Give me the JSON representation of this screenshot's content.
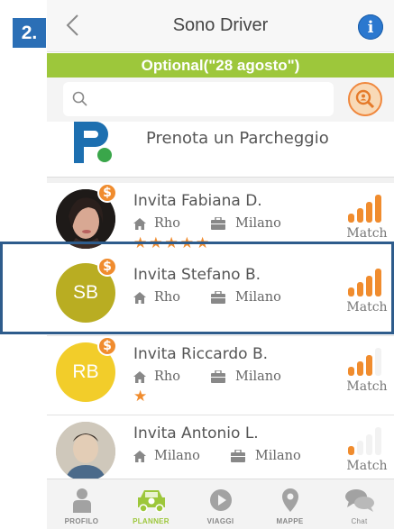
{
  "step_badge": "2.",
  "header": {
    "title": "Sono Driver",
    "info_glyph": "i"
  },
  "banner": {
    "text": "Optional(\"28 agosto\")",
    "color": "#9dc73b"
  },
  "search": {
    "placeholder": ""
  },
  "parking": {
    "label": "Prenota un Parcheggio",
    "logo_letter": "P"
  },
  "rows": [
    {
      "name": "Invita Fabiana D.",
      "home": "Rho",
      "work": "Milano",
      "stars": "★★★★★",
      "match_level": 4,
      "match_label": "Match",
      "avatar_initials": "",
      "avatar_color": "#2b2b2b",
      "has_dollar": true
    },
    {
      "name": "Invita Stefano B.",
      "home": "Rho",
      "work": "Milano",
      "stars": "",
      "match_level": 4,
      "match_label": "Match",
      "avatar_initials": "SB",
      "avatar_color": "#b9ad22",
      "has_dollar": true
    },
    {
      "name": "Invita Riccardo B.",
      "home": "Rho",
      "work": "Milano",
      "stars": "★",
      "match_level": 3,
      "match_label": "Match",
      "avatar_initials": "RB",
      "avatar_color": "#f2cd2a",
      "has_dollar": true
    },
    {
      "name": "Invita Antonio L.",
      "home": "Milano",
      "work": "Milano",
      "stars": "",
      "match_level": 1,
      "match_label": "Match",
      "avatar_initials": "",
      "avatar_color": "#c9c3b6",
      "has_dollar": false
    }
  ],
  "tabs": [
    {
      "label": "PROFILO",
      "icon": "person-icon",
      "active": false
    },
    {
      "label": "PLANNER",
      "icon": "car-icon",
      "active": true
    },
    {
      "label": "VIAGGI",
      "icon": "play-icon",
      "active": false
    },
    {
      "label": "MAPPE",
      "icon": "map-pin-icon",
      "active": false
    },
    {
      "label": "Chat",
      "icon": "chat-icon",
      "active": false
    }
  ],
  "colors": {
    "accent_orange": "#f08c2e",
    "accent_green": "#9dc73b",
    "info_blue": "#2b78cf",
    "highlight_border": "#2e5c8c"
  }
}
